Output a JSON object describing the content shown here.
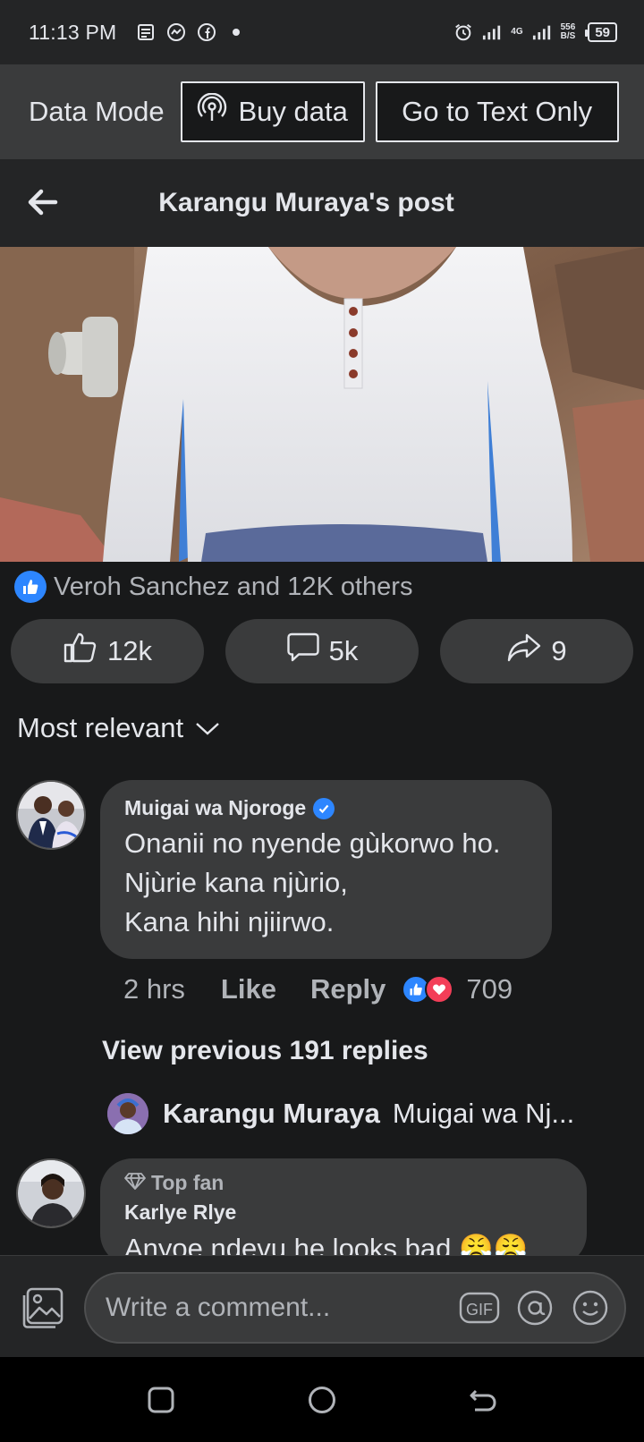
{
  "status_bar": {
    "time": "11:13 PM",
    "net_speed_value": "556",
    "net_speed_unit": "B/S",
    "network_type": "4G",
    "battery": "59"
  },
  "data_mode": {
    "label": "Data Mode",
    "buy_data": "Buy data",
    "text_only": "Go to Text Only"
  },
  "header": {
    "title": "Karangu Muraya's post"
  },
  "post": {
    "reactions_summary": "Veroh Sanchez and 12K others",
    "like_count": "12k",
    "comment_count": "5k",
    "share_count": "9"
  },
  "sort": {
    "label": "Most relevant"
  },
  "comments": [
    {
      "author": "Muigai wa Njoroge",
      "lines": [
        "Onanii no nyende gùkorwo ho.",
        "Njùrie kana njùrio,",
        "Kana hihi njiirwo."
      ],
      "time": "2 hrs",
      "like_label": "Like",
      "reply_label": "Reply",
      "reaction_count": "709",
      "view_previous": "View previous 191 replies",
      "latest_reply": {
        "author": "Karangu Muraya",
        "text": "Muigai wa Nj..."
      }
    },
    {
      "badge": "Top fan",
      "author": "Karlye Rlye",
      "text": "Anyoe ndevu he looks bad 😤😤"
    }
  ],
  "composer": {
    "placeholder": "Write a comment...",
    "gif_label": "GIF"
  },
  "colors": {
    "accent": "#2d86ff",
    "love": "#f33e58",
    "bg": "#18191a",
    "surface": "#3a3b3c"
  }
}
